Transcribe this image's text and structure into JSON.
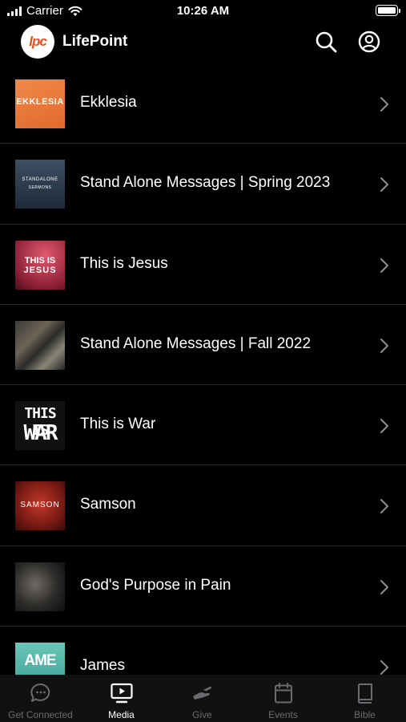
{
  "status_bar": {
    "carrier": "Carrier",
    "time": "10:26 AM"
  },
  "header": {
    "logo_text": "lpc",
    "title": "LifePoint"
  },
  "series": [
    {
      "title": "Ekklesia",
      "thumb_text": "EKKLESIA"
    },
    {
      "title": "Stand Alone Messages | Spring 2023",
      "thumb_text": "STANDALONE",
      "thumb_sub": "SERMONS"
    },
    {
      "title": "This is Jesus",
      "thumb_text": "THIS IS",
      "thumb_sub": "JESUS"
    },
    {
      "title": "Stand Alone Messages | Fall 2022"
    },
    {
      "title": "This is War",
      "thumb_text": "THIS IS",
      "thumb_sub": "WAR"
    },
    {
      "title": "Samson",
      "thumb_text": "SAMSON"
    },
    {
      "title": "God's Purpose in Pain"
    },
    {
      "title": "James",
      "thumb_text": "AME"
    }
  ],
  "tabs": [
    {
      "label": "Get Connected",
      "icon": "chat-bubble-icon",
      "active": false
    },
    {
      "label": "Media",
      "icon": "tv-play-icon",
      "active": true
    },
    {
      "label": "Give",
      "icon": "give-hand-icon",
      "active": false
    },
    {
      "label": "Events",
      "icon": "calendar-icon",
      "active": false
    },
    {
      "label": "Bible",
      "icon": "book-icon",
      "active": false
    }
  ],
  "colors": {
    "brand": "#e8501a",
    "inactive_tab": "#6b6b6f",
    "active_tab": "#ffffff"
  }
}
